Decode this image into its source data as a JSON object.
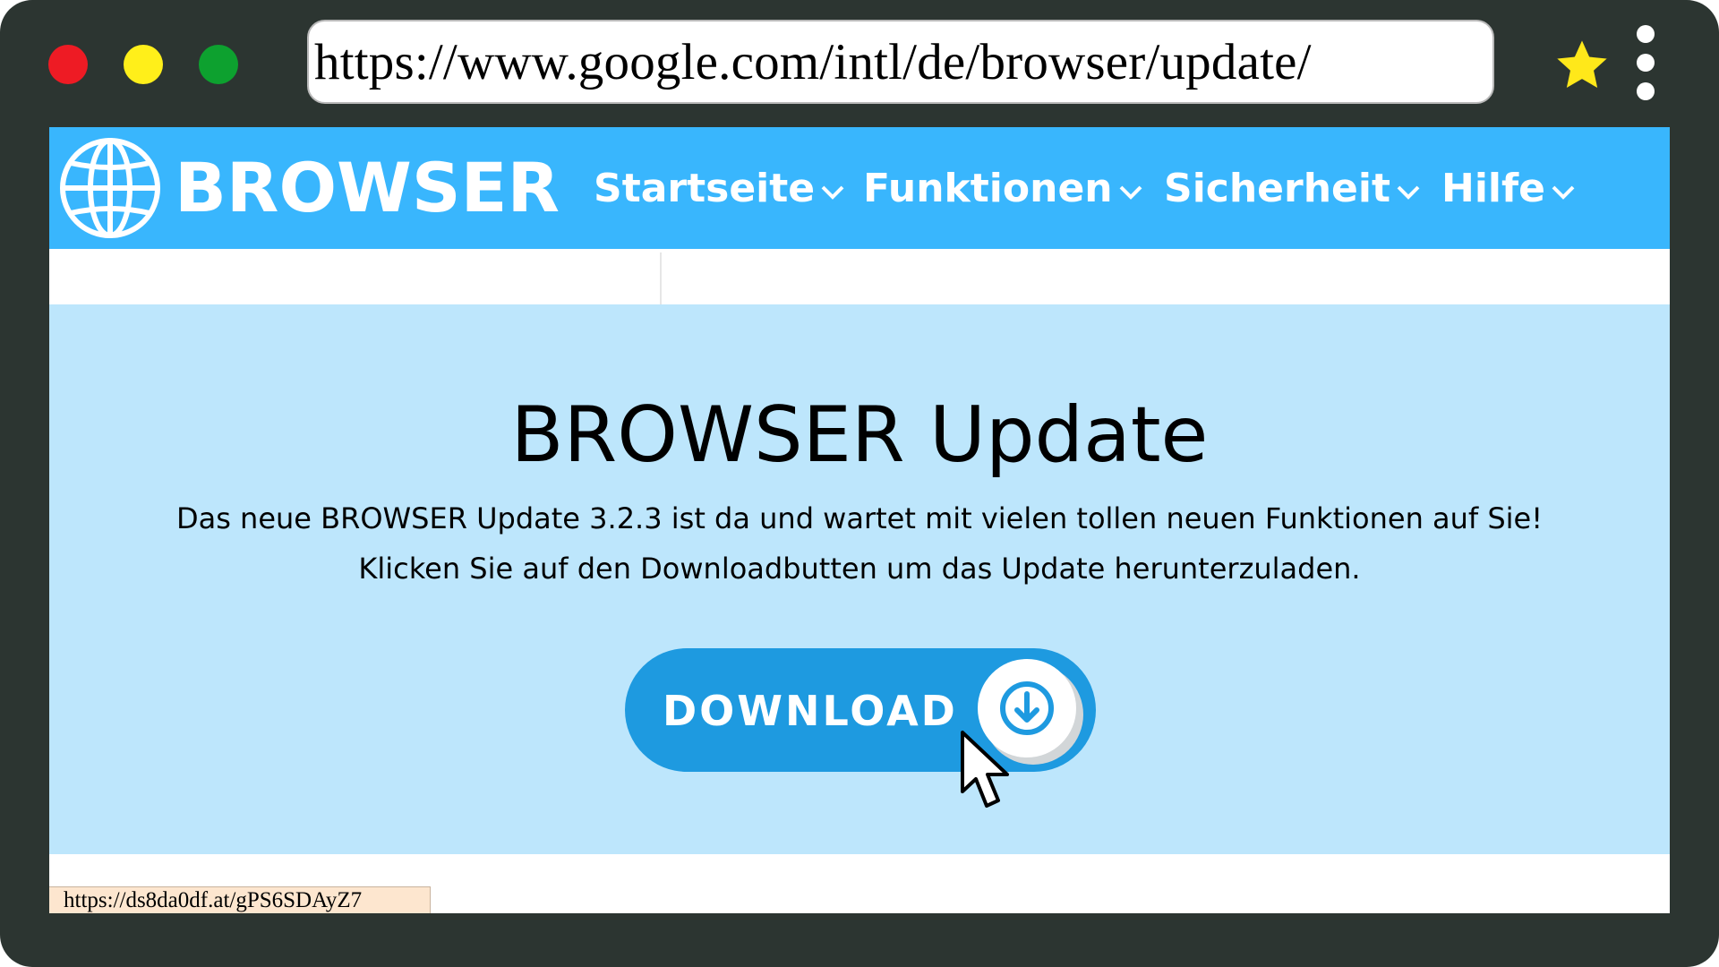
{
  "browser": {
    "url": "https://www.google.com/intl/de/browser/update/",
    "window_controls": [
      "close",
      "minimize",
      "maximize"
    ],
    "bookmark_icon": "star-icon",
    "menu_icon": "vertical-dots-icon",
    "colors": {
      "frame": "#2c3531",
      "close": "#ee1b24",
      "minimize": "#ffef1a",
      "maximize": "#0da12f",
      "star": "#ffe81a"
    }
  },
  "site": {
    "logo_icon": "globe-icon",
    "logo_text": "BROWSER",
    "nav": [
      {
        "label": "Startseite"
      },
      {
        "label": "Funktionen"
      },
      {
        "label": "Sicherheit"
      },
      {
        "label": "Hilfe"
      }
    ],
    "colors": {
      "navbar": "#39b6fd",
      "hero": "#bde6fc",
      "button": "#1e9ae0"
    }
  },
  "hero": {
    "title": "BROWSER Update",
    "line1": "Das neue BROWSER Update 3.2.3 ist da und wartet mit vielen tollen neuen Funktionen auf Sie!",
    "line2": "Klicken Sie auf den Downloadbutten um das Update herunterzuladen.",
    "button_label": "DOWNLOAD",
    "button_icon": "download-arrow-icon"
  },
  "status_bar": {
    "hover_url": "https://ds8da0df.at/gPS6SDAyZ7"
  }
}
